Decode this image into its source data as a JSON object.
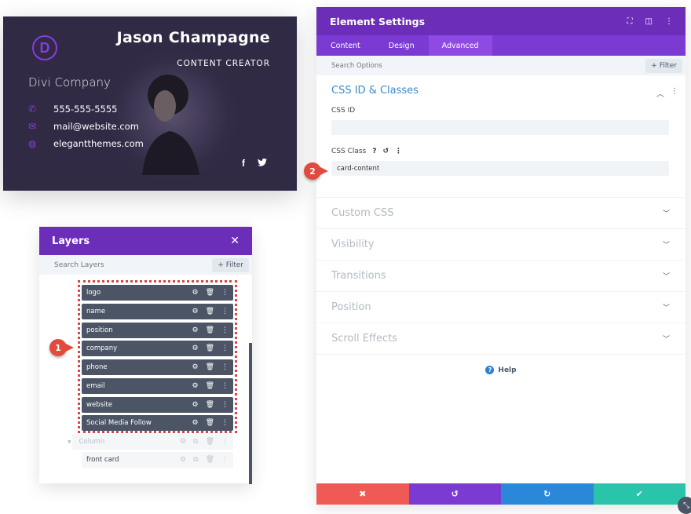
{
  "card": {
    "logo_letter": "D",
    "name": "Jason Champagne",
    "position": "CONTENT CREATOR",
    "company": "Divi Company",
    "phone": "555-555-5555",
    "email": "mail@website.com",
    "website": "elegantthemes.com",
    "social": [
      "f",
      "t"
    ],
    "accent": "#8a3bdc",
    "background": "#302a45"
  },
  "layers": {
    "title": "Layers",
    "close": "✕",
    "search_placeholder": "Search Layers",
    "filter_label": "+ Filter",
    "items": [
      {
        "label": "logo"
      },
      {
        "label": "name"
      },
      {
        "label": "position"
      },
      {
        "label": "company"
      },
      {
        "label": "phone"
      },
      {
        "label": "email"
      },
      {
        "label": "website"
      },
      {
        "label": "Social Media Follow"
      }
    ],
    "column_label": "Column",
    "front_card_label": "front card",
    "badge": "1"
  },
  "settings": {
    "title": "Element Settings",
    "tabs": [
      {
        "label": "Content",
        "active": false
      },
      {
        "label": "Design",
        "active": false
      },
      {
        "label": "Advanced",
        "active": true
      }
    ],
    "search_placeholder": "Search Options",
    "filter_label": "+ Filter",
    "open_section": {
      "title": "CSS ID & Classes",
      "css_id_label": "CSS ID",
      "css_id_value": "",
      "css_class_label": "CSS Class",
      "css_class_value": "card-content"
    },
    "sections": [
      {
        "label": "Custom CSS"
      },
      {
        "label": "Visibility"
      },
      {
        "label": "Transitions"
      },
      {
        "label": "Position"
      },
      {
        "label": "Scroll Effects"
      }
    ],
    "help_label": "Help",
    "badge": "2",
    "footer": {
      "cancel": "✖",
      "undo": "↺",
      "redo": "↻",
      "save": "✔",
      "colors": {
        "cancel": "#ef5a56",
        "undo": "#7b3ad1",
        "redo": "#2b87da",
        "save": "#29c4a9"
      }
    }
  }
}
